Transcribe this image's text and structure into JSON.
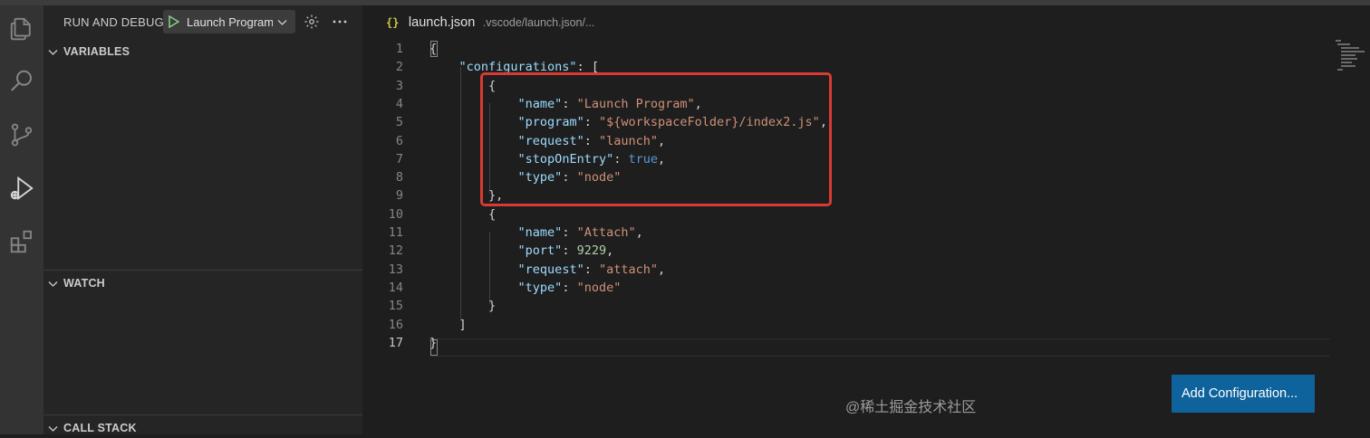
{
  "sidebar": {
    "title": "RUN AND DEBUG",
    "launch_config": "Launch Program",
    "sections": [
      "VARIABLES",
      "WATCH",
      "CALL STACK"
    ]
  },
  "editor": {
    "breadcrumb_icon": "{}",
    "file_name": "launch.json",
    "file_path": ".vscode/launch.json/...",
    "lines": [
      {
        "num": "1",
        "tokens": [
          [
            "p",
            "{"
          ]
        ]
      },
      {
        "num": "2",
        "tokens": [
          [
            "p",
            "    "
          ],
          [
            "k",
            "\"configurations\""
          ],
          [
            "p",
            ": ["
          ]
        ]
      },
      {
        "num": "3",
        "tokens": [
          [
            "p",
            "        {"
          ]
        ]
      },
      {
        "num": "4",
        "tokens": [
          [
            "p",
            "            "
          ],
          [
            "k",
            "\"name\""
          ],
          [
            "p",
            ": "
          ],
          [
            "s",
            "\"Launch Program\""
          ],
          [
            "p",
            ","
          ]
        ]
      },
      {
        "num": "5",
        "tokens": [
          [
            "p",
            "            "
          ],
          [
            "k",
            "\"program\""
          ],
          [
            "p",
            ": "
          ],
          [
            "s",
            "\"${workspaceFolder}/index2.js\""
          ],
          [
            "p",
            ","
          ]
        ]
      },
      {
        "num": "6",
        "tokens": [
          [
            "p",
            "            "
          ],
          [
            "k",
            "\"request\""
          ],
          [
            "p",
            ": "
          ],
          [
            "s",
            "\"launch\""
          ],
          [
            "p",
            ","
          ]
        ]
      },
      {
        "num": "7",
        "tokens": [
          [
            "p",
            "            "
          ],
          [
            "k",
            "\"stopOnEntry\""
          ],
          [
            "p",
            ": "
          ],
          [
            "b",
            "true"
          ],
          [
            "p",
            ","
          ]
        ]
      },
      {
        "num": "8",
        "tokens": [
          [
            "p",
            "            "
          ],
          [
            "k",
            "\"type\""
          ],
          [
            "p",
            ": "
          ],
          [
            "s",
            "\"node\""
          ]
        ]
      },
      {
        "num": "9",
        "tokens": [
          [
            "p",
            "        },"
          ]
        ]
      },
      {
        "num": "10",
        "tokens": [
          [
            "p",
            "        {"
          ]
        ]
      },
      {
        "num": "11",
        "tokens": [
          [
            "p",
            "            "
          ],
          [
            "k",
            "\"name\""
          ],
          [
            "p",
            ": "
          ],
          [
            "s",
            "\"Attach\""
          ],
          [
            "p",
            ","
          ]
        ]
      },
      {
        "num": "12",
        "tokens": [
          [
            "p",
            "            "
          ],
          [
            "k",
            "\"port\""
          ],
          [
            "p",
            ": "
          ],
          [
            "n",
            "9229"
          ],
          [
            "p",
            ","
          ]
        ]
      },
      {
        "num": "13",
        "tokens": [
          [
            "p",
            "            "
          ],
          [
            "k",
            "\"request\""
          ],
          [
            "p",
            ": "
          ],
          [
            "s",
            "\"attach\""
          ],
          [
            "p",
            ","
          ]
        ]
      },
      {
        "num": "14",
        "tokens": [
          [
            "p",
            "            "
          ],
          [
            "k",
            "\"type\""
          ],
          [
            "p",
            ": "
          ],
          [
            "s",
            "\"node\""
          ]
        ]
      },
      {
        "num": "15",
        "tokens": [
          [
            "p",
            "        }"
          ]
        ]
      },
      {
        "num": "16",
        "tokens": [
          [
            "p",
            "    ]"
          ]
        ]
      },
      {
        "num": "17",
        "tokens": [
          [
            "p",
            "}"
          ]
        ]
      }
    ],
    "active_line": "17",
    "add_config_label": "Add Configuration..."
  },
  "watermark": "@稀土掘金技术社区",
  "colors": {
    "highlight_box": "#d93a33",
    "button": "#0e639c",
    "json_key": "#9cdcfe",
    "json_string": "#ce9178",
    "json_number": "#b5cea8",
    "json_bool": "#569cd6",
    "play": "#89d185"
  },
  "icons": {
    "activity_bar": [
      "explorer-icon",
      "search-icon",
      "source-control-icon",
      "run-debug-icon",
      "extensions-icon"
    ]
  }
}
